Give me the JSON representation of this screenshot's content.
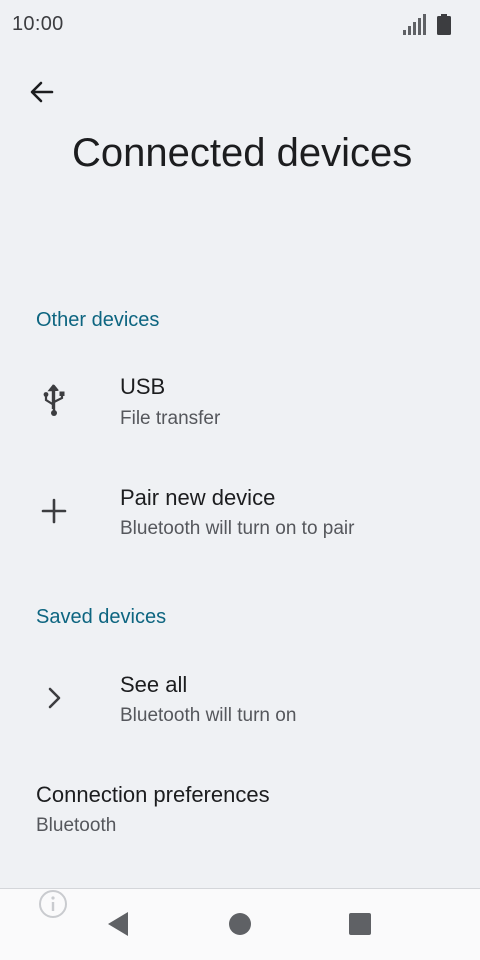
{
  "status_bar": {
    "time": "10:00"
  },
  "header": {
    "title": "Connected devices"
  },
  "sections": {
    "other_devices": "Other devices",
    "saved_devices": "Saved devices"
  },
  "items": {
    "usb": {
      "title": "USB",
      "subtitle": "File transfer",
      "icon": "usb-icon"
    },
    "pair": {
      "title": "Pair new device",
      "subtitle": "Bluetooth will turn on to pair",
      "icon": "plus-icon"
    },
    "see_all": {
      "title": "See all",
      "subtitle": "Bluetooth will turn on",
      "icon": "chevron-right-icon"
    },
    "connection_prefs": {
      "title": "Connection preferences",
      "subtitle": "Bluetooth"
    }
  },
  "colors": {
    "background": "#eff1f4",
    "accent": "#0d6580",
    "text_primary": "#1c1d1f",
    "text_secondary": "#55575c"
  }
}
